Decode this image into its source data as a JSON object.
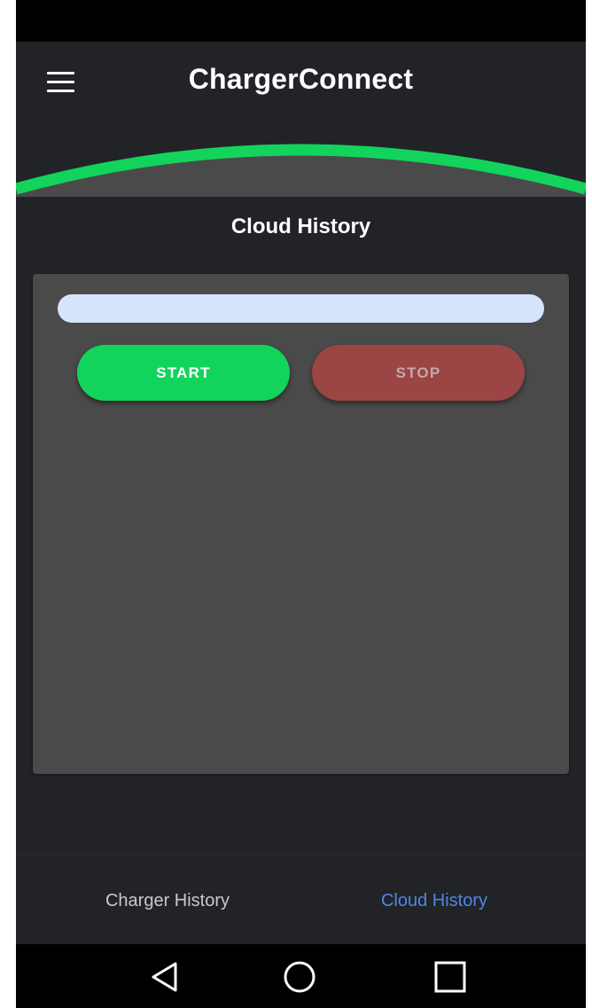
{
  "app": {
    "title": "ChargerConnect"
  },
  "page": {
    "section_title": "Cloud History"
  },
  "card": {
    "start_label": "START",
    "stop_label": "STOP"
  },
  "bottom_nav": {
    "items": [
      {
        "label": "Charger History",
        "active": false
      },
      {
        "label": "Cloud History",
        "active": true
      }
    ]
  },
  "icons": {
    "menu": "hamburger-menu-icon",
    "back": "back-triangle-icon",
    "home": "home-circle-icon",
    "recents": "recents-square-icon"
  },
  "colors": {
    "accent_green": "#12d45c",
    "stop_red": "#9b4545",
    "active_tab_blue": "#4f86e8",
    "background": "#222327",
    "card": "#4a4a4a",
    "progress_track": "#d6e4fb"
  }
}
